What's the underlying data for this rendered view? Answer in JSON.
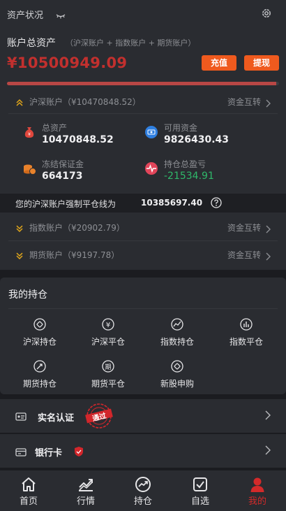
{
  "header": {
    "title": "资产状况"
  },
  "summary": {
    "label": "账户总资产",
    "sub": "（沪深账户 + 指数账户 + 期货账户）",
    "total": "¥10500949.09",
    "deposit": "充值",
    "withdraw": "提现",
    "progress": 0.99
  },
  "shsz": {
    "name": "沪深账户（¥10470848.52）",
    "transfer": "资金互转",
    "stats": [
      {
        "label": "总资产",
        "value": "10470848.52",
        "icon": "money-bag-icon"
      },
      {
        "label": "可用资金",
        "value": "9826430.43",
        "icon": "available-funds-icon"
      },
      {
        "label": "冻结保证金",
        "value": "664173",
        "icon": "coins-icon"
      },
      {
        "label": "持仓总盈亏",
        "value": "-21534.91",
        "icon": "pulse-icon"
      }
    ]
  },
  "warning": {
    "text": "您的沪深账户强制平仓线为",
    "value": "10385697.40"
  },
  "index_acct": {
    "name": "指数账户（¥20902.79）",
    "transfer": "资金互转"
  },
  "futures_acct": {
    "name": "期货账户（¥9197.78）",
    "transfer": "资金互转"
  },
  "holdings": {
    "title": "我的持仓",
    "items": [
      "沪深持仓",
      "沪深平仓",
      "指数持仓",
      "指数平仓",
      "期货持仓",
      "期货平仓",
      "新股申购"
    ]
  },
  "verify": {
    "label": "实名认证",
    "stamp": "通过"
  },
  "bank": {
    "label": "银行卡"
  },
  "tabs": [
    {
      "label": "首页",
      "icon": "home-icon"
    },
    {
      "label": "行情",
      "icon": "market-icon"
    },
    {
      "label": "持仓",
      "icon": "holdings-icon"
    },
    {
      "label": "自选",
      "icon": "favorites-icon"
    },
    {
      "label": "我的",
      "icon": "profile-icon"
    }
  ],
  "colors": {
    "accent": "#ef5a1e",
    "negative": "#c2302e",
    "positive": "#2fb86a",
    "active_tab": "#d32a2a"
  }
}
